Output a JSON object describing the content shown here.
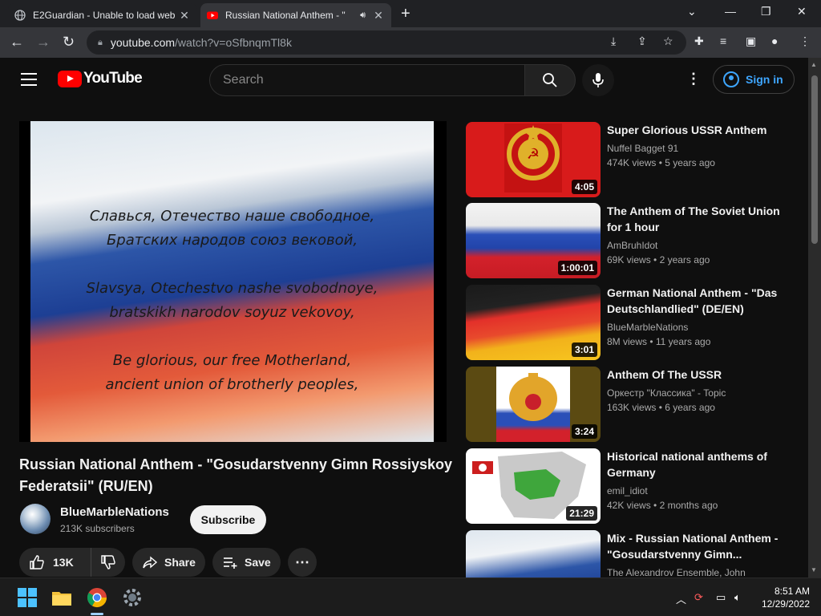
{
  "browser": {
    "tabs": [
      {
        "title": "E2Guardian - Unable to load web",
        "active": false
      },
      {
        "title": "Russian National Anthem - \"",
        "active": true
      }
    ],
    "url_host": "youtube.com",
    "url_path": "/watch?v=oSfbnqmTl8k"
  },
  "header": {
    "logo_text": "YouTube",
    "search_placeholder": "Search",
    "signin_label": "Sign in"
  },
  "player": {
    "lyrics": [
      "Славься, Отечество наше свободное,",
      "Братских народов союз вековой,",
      "",
      "Slavsya, Otechestvo nashe svobodnoye,",
      "bratskikh narodov soyuz vekovoy,",
      "",
      "Be glorious, our free Motherland,",
      "ancient union of brotherly peoples,"
    ]
  },
  "video": {
    "title": "Russian National Anthem - \"Gosudarstvenny Gimn Rossiyskoy Federatsii\" (RU/EN)",
    "channel": "BlueMarbleNations",
    "subscribers": "213K subscribers",
    "subscribe_label": "Subscribe",
    "likes": "13K",
    "share_label": "Share",
    "save_label": "Save"
  },
  "recommendations": [
    {
      "title": "Super Glorious USSR Anthem",
      "channel": "Nuffel Bagget 91",
      "views": "474K views",
      "age": "5 years ago",
      "duration": "4:05"
    },
    {
      "title": "The Anthem of The Soviet Union for 1 hour",
      "channel": "AmBruhIdot",
      "views": "69K views",
      "age": "2 years ago",
      "duration": "1:00:01"
    },
    {
      "title": "German National Anthem - \"Das Deutschlandlied\" (DE/EN)",
      "channel": "BlueMarbleNations",
      "views": "8M views",
      "age": "11 years ago",
      "duration": "3:01"
    },
    {
      "title": "Anthem Of The USSR",
      "channel": "Оркестр \"Классика\" - Topic",
      "views": "163K views",
      "age": "6 years ago",
      "duration": "3:24"
    },
    {
      "title": "Historical national anthems of Germany",
      "channel": "emil_idiot",
      "views": "42K views",
      "age": "2 months ago",
      "duration": "21:29"
    },
    {
      "title": "Mix - Russian National Anthem - \"Gosudarstvenny Gimn...",
      "channel": "The Alexandrov Ensemble, John",
      "views": "",
      "age": "",
      "duration": ""
    }
  ],
  "taskbar": {
    "time": "8:51 AM",
    "date": "12/29/2022"
  }
}
